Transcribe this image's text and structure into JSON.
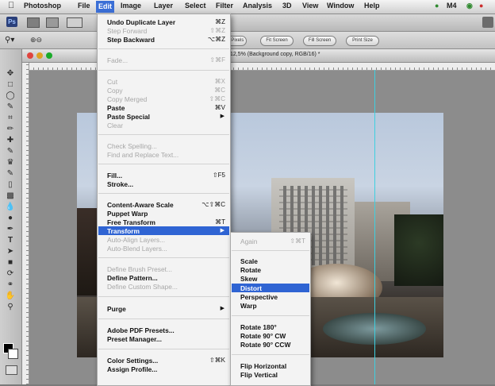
{
  "menubar": {
    "items": [
      "Photoshop",
      "File",
      "Edit",
      "Image",
      "Layer",
      "Select",
      "Filter",
      "Analysis",
      "3D",
      "View",
      "Window",
      "Help"
    ],
    "right_status": "M4"
  },
  "toolbar": {
    "pills": [
      "ActualPixels",
      "Fit Screen",
      "Fill Screen",
      "Print Size"
    ]
  },
  "document": {
    "tab_title": "12,5% (Background copy, RGB/16) *"
  },
  "colors": {
    "menu_highlight": "#2f64d3",
    "menubar_active": "#3b6fd6",
    "guide": "#3fd0e0"
  },
  "edit_menu": {
    "items": [
      {
        "label": "Undo Duplicate Layer",
        "shortcut": "⌘Z",
        "disabled": false,
        "bold": true
      },
      {
        "label": "Step Forward",
        "shortcut": "⇧⌘Z",
        "disabled": true
      },
      {
        "label": "Step Backward",
        "shortcut": "⌥⌘Z",
        "disabled": false,
        "bold": true
      },
      {
        "label": "Fade...",
        "shortcut": "⇧⌘F",
        "disabled": true
      },
      {
        "label": "Cut",
        "shortcut": "⌘X",
        "disabled": true
      },
      {
        "label": "Copy",
        "shortcut": "⌘C",
        "disabled": true
      },
      {
        "label": "Copy Merged",
        "shortcut": "⇧⌘C",
        "disabled": true
      },
      {
        "label": "Paste",
        "shortcut": "⌘V",
        "disabled": false,
        "bold": true
      },
      {
        "label": "Paste Special",
        "shortcut": "",
        "disabled": false,
        "bold": true,
        "submenu": true
      },
      {
        "label": "Clear",
        "shortcut": "",
        "disabled": true
      },
      {
        "label": "Check Spelling...",
        "shortcut": "",
        "disabled": true
      },
      {
        "label": "Find and Replace Text...",
        "shortcut": "",
        "disabled": true
      },
      {
        "label": "Fill...",
        "shortcut": "⇧F5",
        "disabled": false,
        "bold": true
      },
      {
        "label": "Stroke...",
        "shortcut": "",
        "disabled": false,
        "bold": true
      },
      {
        "label": "Content-Aware Scale",
        "shortcut": "⌥⇧⌘C",
        "disabled": false,
        "bold": true
      },
      {
        "label": "Puppet Warp",
        "shortcut": "",
        "disabled": false,
        "bold": true
      },
      {
        "label": "Free Transform",
        "shortcut": "⌘T",
        "disabled": false,
        "bold": true
      },
      {
        "label": "Transform",
        "shortcut": "",
        "disabled": false,
        "bold": true,
        "submenu": true,
        "highlighted": true
      },
      {
        "label": "Auto-Align Layers...",
        "shortcut": "",
        "disabled": true
      },
      {
        "label": "Auto-Blend Layers...",
        "shortcut": "",
        "disabled": true
      },
      {
        "label": "Define Brush Preset...",
        "shortcut": "",
        "disabled": true
      },
      {
        "label": "Define Pattern...",
        "shortcut": "",
        "disabled": false,
        "bold": true
      },
      {
        "label": "Define Custom Shape...",
        "shortcut": "",
        "disabled": true
      },
      {
        "label": "Purge",
        "shortcut": "",
        "disabled": false,
        "bold": true,
        "submenu": true
      },
      {
        "label": "Adobe PDF Presets...",
        "shortcut": "",
        "disabled": false,
        "bold": true
      },
      {
        "label": "Preset Manager...",
        "shortcut": "",
        "disabled": false,
        "bold": true
      },
      {
        "label": "Color Settings...",
        "shortcut": "⇧⌘K",
        "disabled": false,
        "bold": true
      },
      {
        "label": "Assign Profile...",
        "shortcut": "",
        "disabled": false,
        "bold": true
      }
    ]
  },
  "transform_menu": {
    "items": [
      {
        "label": "Again",
        "shortcut": "⇧⌘T",
        "disabled": true
      },
      {
        "label": "Scale",
        "disabled": false
      },
      {
        "label": "Rotate",
        "disabled": false
      },
      {
        "label": "Skew",
        "disabled": false
      },
      {
        "label": "Distort",
        "disabled": false,
        "highlighted": true
      },
      {
        "label": "Perspective",
        "disabled": false
      },
      {
        "label": "Warp",
        "disabled": false
      },
      {
        "label": "Rotate 180°",
        "disabled": false
      },
      {
        "label": "Rotate 90° CW",
        "disabled": false
      },
      {
        "label": "Rotate 90° CCW",
        "disabled": false
      },
      {
        "label": "Flip Horizontal",
        "disabled": false
      },
      {
        "label": "Flip Vertical",
        "disabled": false
      }
    ]
  },
  "icons": [
    "apple-icon",
    "wifi-icon",
    "clock-icon",
    "zoom-tool-icon",
    "move-tool-icon",
    "marquee-tool-icon",
    "lasso-tool-icon",
    "crop-tool-icon",
    "brush-tool-icon",
    "eraser-tool-icon",
    "pen-tool-icon",
    "type-tool-icon",
    "hand-tool-icon",
    "foreground-color-swatch",
    "submenu-arrow-icon"
  ]
}
